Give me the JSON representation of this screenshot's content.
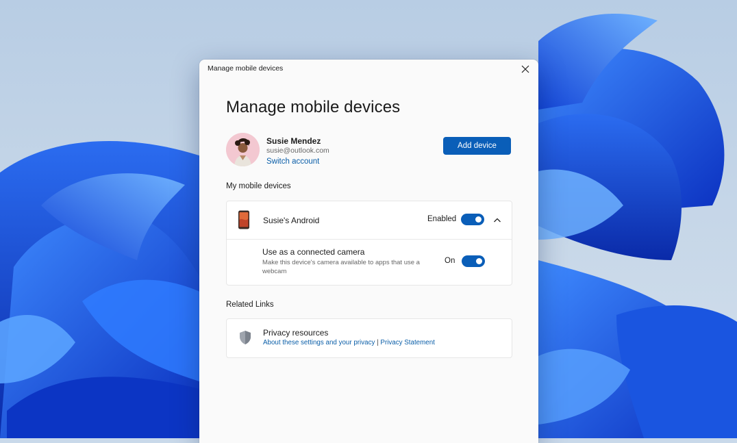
{
  "dialog": {
    "window_title": "Manage mobile devices",
    "heading": "Manage mobile devices"
  },
  "account": {
    "name": "Susie Mendez",
    "email": "susie@outlook.com",
    "switch_label": "Switch account",
    "add_device_label": "Add device"
  },
  "devices": {
    "section_label": "My mobile devices",
    "items": [
      {
        "name": "Susie's Android",
        "status_label": "Enabled",
        "enabled": true,
        "expanded": true,
        "icon": "phone-icon",
        "settings": [
          {
            "title": "Use as a connected camera",
            "description": "Make this device's camera available to apps that use a webcam",
            "state_label": "On",
            "on": true
          }
        ]
      }
    ]
  },
  "related": {
    "section_label": "Related Links",
    "privacy_title": "Privacy resources",
    "link1": "About these settings and your privacy",
    "separator": "|",
    "link2": "Privacy Statement",
    "icon": "shield-icon"
  },
  "colors": {
    "accent": "#0a5eb8",
    "link": "#0a5ea8",
    "wallpaper_sky": "#c9d9ea",
    "bloom_blue": "#1a55e0"
  }
}
